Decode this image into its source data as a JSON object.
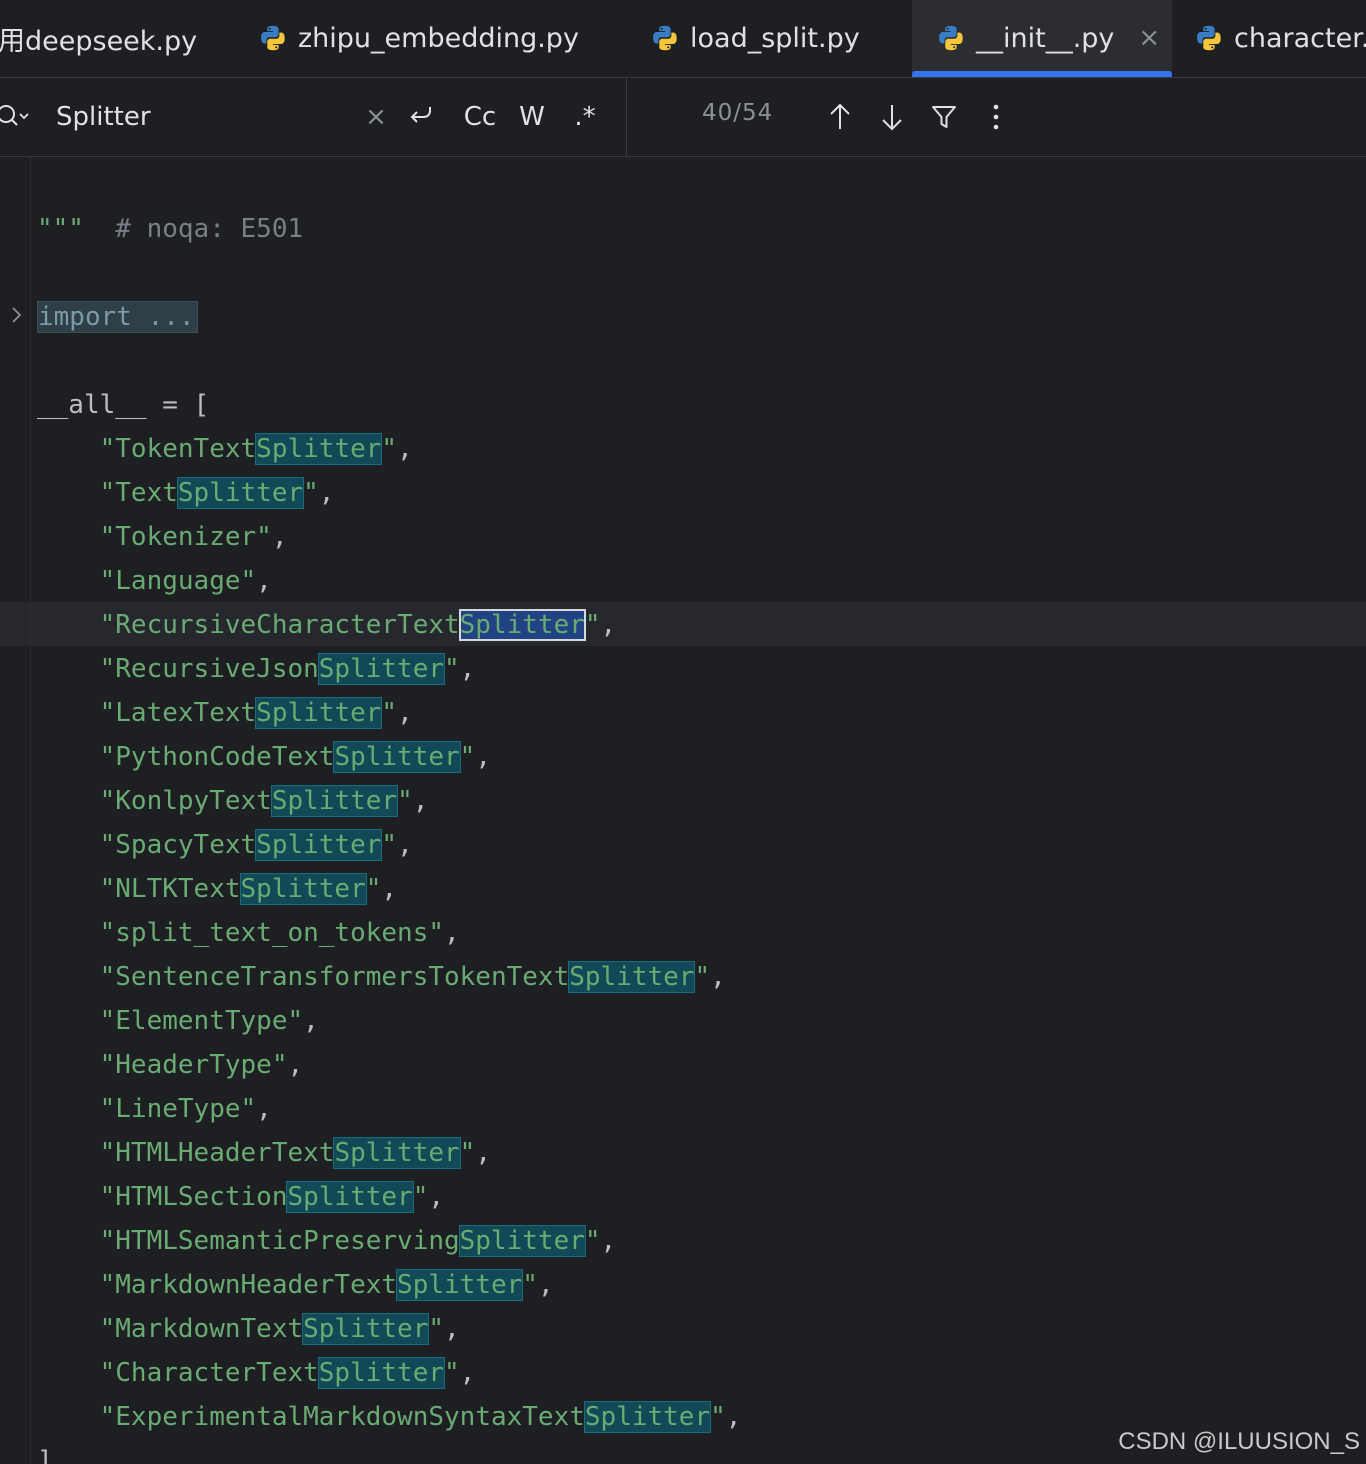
{
  "tabs": [
    {
      "label": "用deepseek.py",
      "icon": "python-file-icon",
      "active": false
    },
    {
      "label": "zhipu_embedding.py",
      "icon": "python-file-icon",
      "active": false
    },
    {
      "label": "load_split.py",
      "icon": "python-file-icon",
      "active": false
    },
    {
      "label": "__init__.py",
      "icon": "python-file-icon",
      "active": true,
      "close": "×"
    },
    {
      "label": "character.p",
      "icon": "python-file-icon",
      "active": false
    }
  ],
  "find": {
    "query": "Splitter",
    "clear": "×",
    "match_case_label": "Cc",
    "words_label": "W",
    "regex_label": ".*",
    "count": "40/54"
  },
  "editor": {
    "docstring_end": "\"\"\"",
    "noqa_comment": "# noqa: E501",
    "import_fold": "import ...",
    "all_open": "__all__ = [",
    "all_close": "]",
    "entries": [
      {
        "prefix": "TokenText",
        "match": "Splitter"
      },
      {
        "prefix": "Text",
        "match": "Splitter"
      },
      {
        "prefix": "Tokenizer",
        "match": ""
      },
      {
        "prefix": "Language",
        "match": ""
      },
      {
        "prefix": "RecursiveCharacterText",
        "match": "Splitter",
        "current": true
      },
      {
        "prefix": "RecursiveJson",
        "match": "Splitter"
      },
      {
        "prefix": "LatexText",
        "match": "Splitter"
      },
      {
        "prefix": "PythonCodeText",
        "match": "Splitter"
      },
      {
        "prefix": "KonlpyText",
        "match": "Splitter"
      },
      {
        "prefix": "SpacyText",
        "match": "Splitter"
      },
      {
        "prefix": "NLTKText",
        "match": "Splitter"
      },
      {
        "prefix": "split_text_on_tokens",
        "match": ""
      },
      {
        "prefix": "SentenceTransformersTokenText",
        "match": "Splitter"
      },
      {
        "prefix": "ElementType",
        "match": ""
      },
      {
        "prefix": "HeaderType",
        "match": ""
      },
      {
        "prefix": "LineType",
        "match": ""
      },
      {
        "prefix": "HTMLHeaderText",
        "match": "Splitter"
      },
      {
        "prefix": "HTMLSection",
        "match": "Splitter"
      },
      {
        "prefix": "HTMLSemanticPreserving",
        "match": "Splitter"
      },
      {
        "prefix": "MarkdownHeaderText",
        "match": "Splitter"
      },
      {
        "prefix": "MarkdownText",
        "match": "Splitter"
      },
      {
        "prefix": "CharacterText",
        "match": "Splitter"
      },
      {
        "prefix": "ExperimentalMarkdownSyntaxText",
        "match": "Splitter"
      }
    ]
  },
  "watermark": "CSDN @ILUUSION_S",
  "colors": {
    "background": "#1e1f22",
    "accent": "#3574f0",
    "string": "#6aab73",
    "match_highlight": "#114957",
    "current_match": "#214283"
  }
}
